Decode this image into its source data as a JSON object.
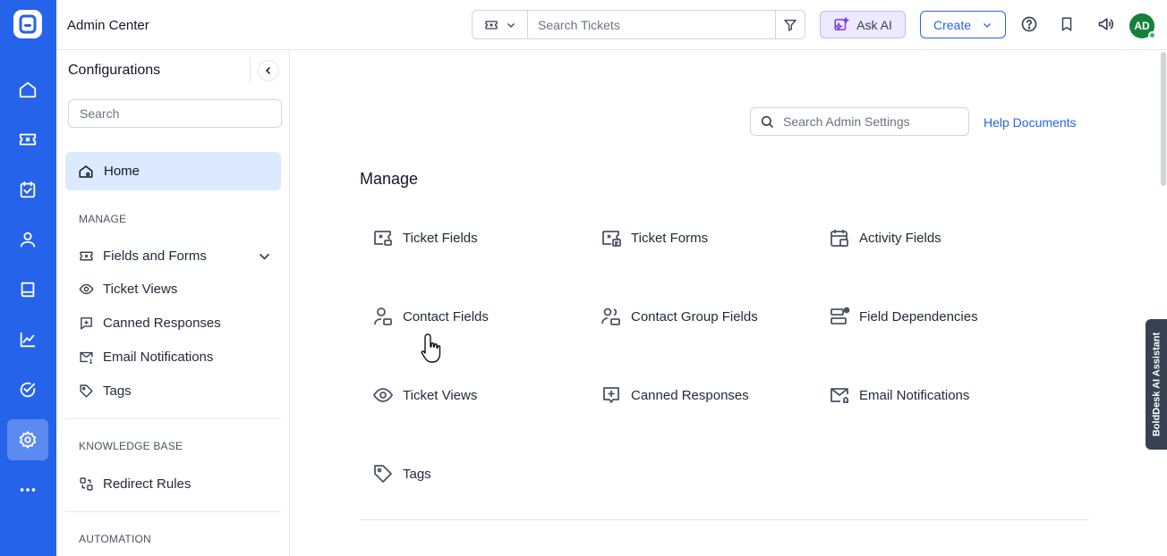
{
  "header": {
    "app_title": "Admin Center",
    "search_placeholder": "Search Tickets",
    "ask_ai_label": "Ask AI",
    "create_label": "Create",
    "avatar_initials": "AD",
    "brand_color": "#2563eb"
  },
  "rail": {
    "items": [
      "home-icon",
      "ticket-icon",
      "calendar-check-icon",
      "user-icon",
      "book-icon",
      "chart-icon",
      "check-circle-icon",
      "gear-icon",
      "more-icon"
    ],
    "active": "gear-icon"
  },
  "sidebar": {
    "title": "Configurations",
    "search_placeholder": "Search",
    "home_label": "Home",
    "sections": {
      "manage": {
        "label": "MANAGE",
        "items": [
          "Fields and Forms",
          "Ticket Views",
          "Canned Responses",
          "Email Notifications",
          "Tags"
        ]
      },
      "knowledge_base": {
        "label": "KNOWLEDGE BASE",
        "items": [
          "Redirect Rules"
        ]
      },
      "automation": {
        "label": "AUTOMATION"
      }
    }
  },
  "main": {
    "search_placeholder": "Search Admin Settings",
    "help_label": "Help Documents",
    "section_title": "Manage",
    "tiles": [
      "Ticket Fields",
      "Ticket Forms",
      "Activity Fields",
      "Contact Fields",
      "Contact Group Fields",
      "Field Dependencies",
      "Ticket Views",
      "Canned Responses",
      "Email Notifications",
      "Tags"
    ]
  },
  "assistant_tab_label": "BoldDesk AI Assistant"
}
